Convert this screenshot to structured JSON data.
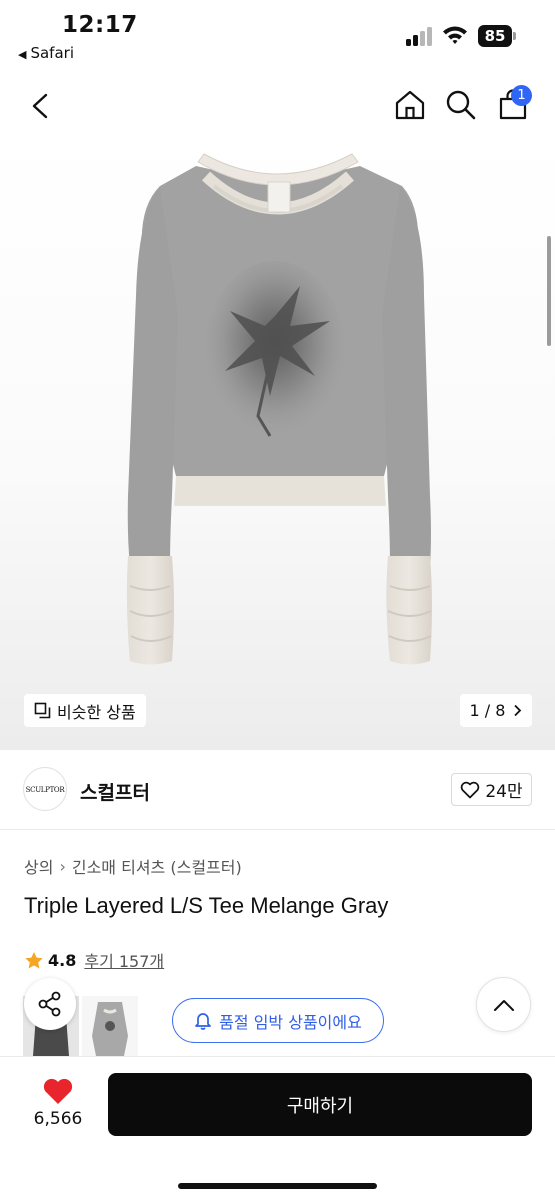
{
  "status_bar": {
    "time": "12:17",
    "back_app": "Safari",
    "battery": "85"
  },
  "nav": {
    "cart_count": "1",
    "icons": [
      "chevron-left-icon",
      "home-icon",
      "search-icon",
      "shopping-bag-icon"
    ]
  },
  "hero": {
    "similar_label": "비슷한 상품",
    "page_indicator": "1 / 8"
  },
  "brand": {
    "logo_text": "SCULPTOR",
    "name": "스컬프터",
    "likes": "24만"
  },
  "product": {
    "breadcrumb_category": "상의",
    "breadcrumb_sub": "긴소매 티셔츠 (스컬프터)",
    "title": "Triple Layered L/S Tee Melange Gray",
    "rating": "4.8",
    "reviews": "후기 157개"
  },
  "alert": {
    "label": "품절 임박 상품이에요"
  },
  "bottom": {
    "wish_count": "6,566",
    "buy_label": "구매하기"
  },
  "colors": {
    "accent_blue": "#2f66f6",
    "heart_red": "#e8242c",
    "star_orange": "#f5a623",
    "buy_button": "#0b0b0b"
  }
}
